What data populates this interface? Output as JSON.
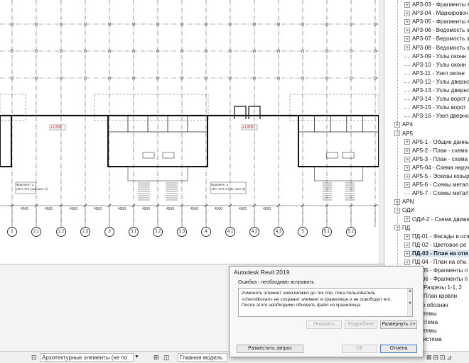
{
  "drawing": {
    "grid_labels": [
      "2",
      "2.1",
      "2.2",
      "2.3",
      "3",
      "3.1",
      "3.2",
      "3.3",
      "4",
      "4.1",
      "4.2",
      "4.3",
      "5",
      "5.1",
      "5.2"
    ],
    "dim_labels": [
      "4500",
      "4500",
      "4500",
      "4500",
      "4500",
      "4500",
      "4500",
      "4500",
      "4500",
      "4500",
      "4500"
    ],
    "fragment_1": [
      "Фрагмент 1",
      "АЕЧ АР1 (см. лист 3)"
    ],
    "fragment_2": [
      "Фрагмент 2",
      "АЕЧ АР2-3 (см. лист 3)"
    ],
    "level_mark": "+1.800"
  },
  "browser": {
    "rows": [
      {
        "toggle": "+",
        "label": "АР3-03 - Фрагменты м",
        "indent": 2
      },
      {
        "toggle": "+",
        "label": "АР3-04 - Маркировоч",
        "indent": 2
      },
      {
        "toggle": "+",
        "label": "АР3-05 - Фрагменты м",
        "indent": 2
      },
      {
        "toggle": "+",
        "label": "АР3-06 - Ведомость за",
        "indent": 2
      },
      {
        "toggle": "+",
        "label": "АР3-07 - Ведомость за",
        "indent": 2
      },
      {
        "toggle": "+",
        "label": "АР3-08 - Ведомость за",
        "indent": 2
      },
      {
        "toggle": "",
        "label": "АР3-09 - Узлы оконн",
        "indent": 2
      },
      {
        "toggle": "",
        "label": "АР3-10 - Узлы оконн",
        "indent": 2
      },
      {
        "toggle": "",
        "label": "АР3-11 - Узел оконн",
        "indent": 2
      },
      {
        "toggle": "",
        "label": "АР3-12 - Узлы дверно",
        "indent": 2
      },
      {
        "toggle": "",
        "label": "АР3-13 - Узлы дверно",
        "indent": 2
      },
      {
        "toggle": "",
        "label": "АР3-14 - Узлы ворот д",
        "indent": 2
      },
      {
        "toggle": "",
        "label": "АР3-15 - Узлы ворот",
        "indent": 2
      },
      {
        "toggle": "",
        "label": "АР3-16 - Узел дверно",
        "indent": 2
      },
      {
        "toggle": "+",
        "label": "АР4",
        "indent": 1
      },
      {
        "toggle": "−",
        "label": "АР5",
        "indent": 1
      },
      {
        "toggle": "+",
        "label": "АР5-1 - Общие данны",
        "indent": 2
      },
      {
        "toggle": "+",
        "label": "АР5-2 - План - схема",
        "indent": 2
      },
      {
        "toggle": "+",
        "label": "АР5-3 - План - схема",
        "indent": 2
      },
      {
        "toggle": "+",
        "label": "АР5-04 - Схема наруж",
        "indent": 2
      },
      {
        "toggle": "+",
        "label": "АР5-5 - Эскизы козыр",
        "indent": 2
      },
      {
        "toggle": "+",
        "label": "АР5-6 - Схемы метал",
        "indent": 2
      },
      {
        "toggle": "",
        "label": "АР5-7 - Схемы метал",
        "indent": 2
      },
      {
        "toggle": "+",
        "label": "АРN",
        "indent": 1
      },
      {
        "toggle": "−",
        "label": "ОДИ",
        "indent": 1
      },
      {
        "toggle": "+",
        "label": "ОДИ-2 - Схема движе",
        "indent": 2
      },
      {
        "toggle": "−",
        "label": "ПД",
        "indent": 1
      },
      {
        "toggle": "+",
        "label": "ПД-01 - Фасады в ося",
        "indent": 2
      },
      {
        "toggle": "+",
        "label": "ПД-02 - Цветовое ре",
        "indent": 2
      },
      {
        "toggle": "+",
        "label": "ПД-03 - План на отм",
        "indent": 2,
        "bold": true
      },
      {
        "toggle": "+",
        "label": "ПД-04 - План на отм.",
        "indent": 2
      },
      {
        "toggle": "+",
        "label": "ПД-05 - Фрагменты п",
        "indent": 2
      },
      {
        "toggle": "+",
        "label": "ПД-06 - Фрагменты п",
        "indent": 2
      },
      {
        "toggle": "",
        "label": "07 - Разрезы 1-1, 2",
        "indent": 2
      },
      {
        "toggle": "",
        "label": "08 - План кровли",
        "indent": 2
      },
      {
        "toggle": "",
        "label": "ционные обознач",
        "indent": 1
      },
      {
        "toggle": "",
        "label": "ные системы",
        "indent": 1
      },
      {
        "toggle": "",
        "label": "чная система",
        "indent": 1
      },
      {
        "toggle": "",
        "label": "ные системы",
        "indent": 1
      },
      {
        "toggle": "",
        "label": "ажная система",
        "indent": 1
      }
    ]
  },
  "dialog": {
    "title": "Autodesk Revit 2019",
    "error_heading": "Ошибка - необходимо исправить",
    "message_lines": [
      "Изменить элемент невозможно до тех пор, пока пользователь",
      "«cherniikovan» не сохранит элемент в хранилище и не освободит его.",
      "После этого необходимо обновить файл из хранилища."
    ],
    "btn_show": "Показать",
    "btn_more": "Подробнее",
    "btn_expand": "Развернуть >>",
    "btn_request": "Разместить запрос",
    "btn_ok": "ОК",
    "btn_cancel": "Отмена"
  },
  "statusbar": {
    "filter_label": "Архитектурные элементы (не по",
    "model_label": "Главная модель",
    "right_text": "по роли в сп..."
  }
}
